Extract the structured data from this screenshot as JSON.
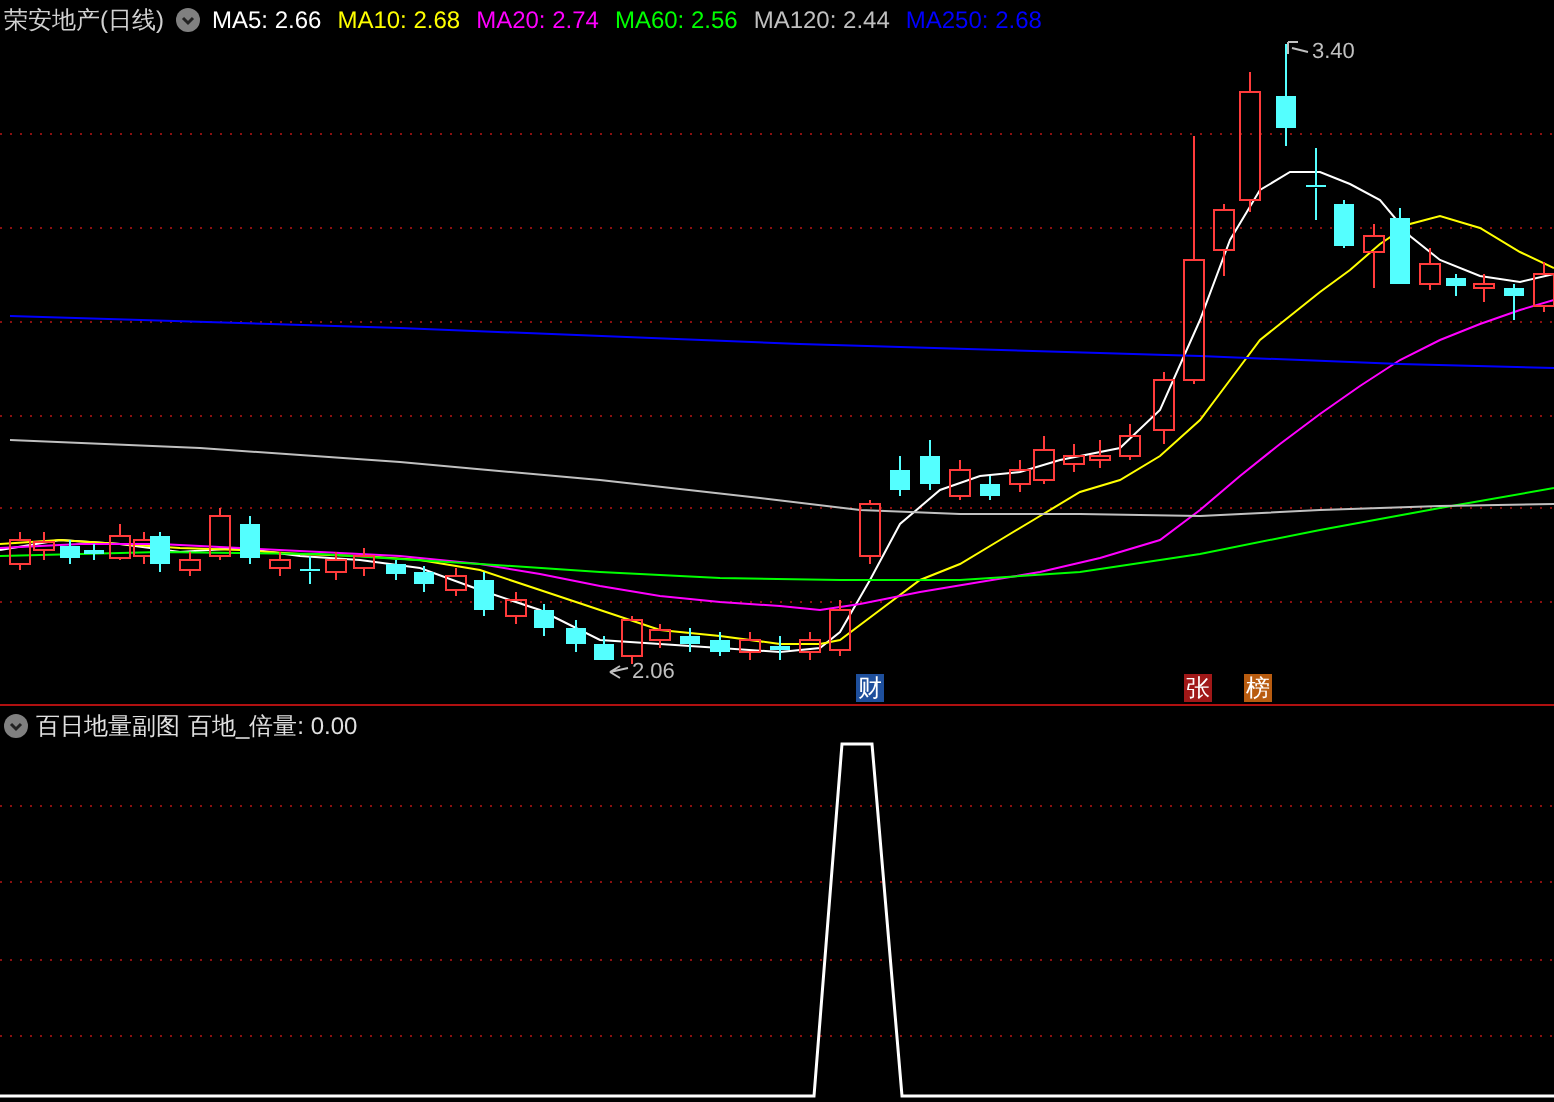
{
  "chart": {
    "title": "荣安地产(日线)",
    "moving_averages": [
      {
        "label": "MA5: 2.66",
        "color": "#ffffff"
      },
      {
        "label": "MA10: 2.68",
        "color": "#ffff00"
      },
      {
        "label": "MA20: 2.74",
        "color": "#ff00ff"
      },
      {
        "label": "MA60: 2.56",
        "color": "#00ff00"
      },
      {
        "label": "MA120: 2.44",
        "color": "#c0c0c0"
      },
      {
        "label": "MA250: 2.68",
        "color": "#0000ff"
      }
    ],
    "high_label": "3.40",
    "low_label": "2.06",
    "markers": [
      {
        "text": "财",
        "color": "#1e4f9c"
      },
      {
        "text": "张",
        "color": "#a01818"
      },
      {
        "text": "榜",
        "color": "#b85c10"
      }
    ]
  },
  "sub_chart": {
    "title": "百日地量副图",
    "indicator": "百地_倍量: 0.00"
  }
}
